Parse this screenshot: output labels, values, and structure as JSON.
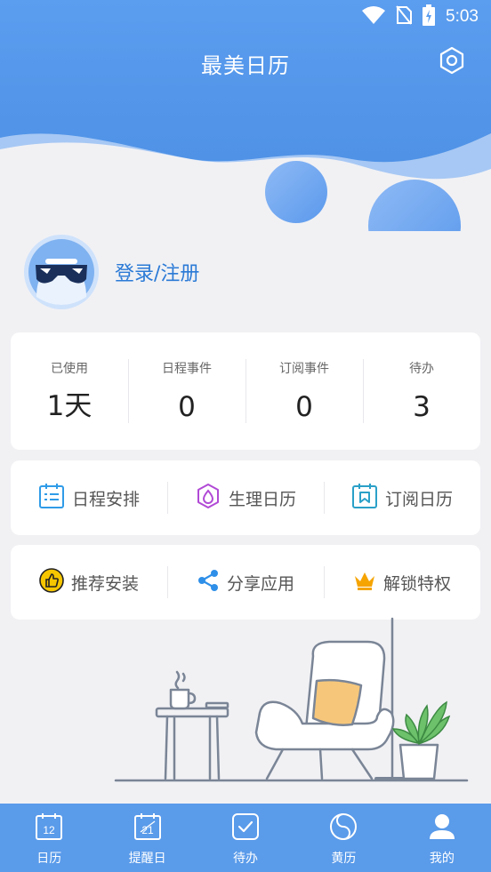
{
  "status_bar": {
    "time": "5:03",
    "icons": [
      "wifi-icon",
      "no-sim-icon",
      "battery-charging-icon"
    ]
  },
  "header": {
    "title": "最美日历",
    "settings_icon": "gear-icon"
  },
  "profile": {
    "login_label": "登录/注册",
    "avatar_icon": "avatar-sunglasses-icon"
  },
  "stats": [
    {
      "label": "已使用",
      "value": "1天"
    },
    {
      "label": "日程事件",
      "value": "0"
    },
    {
      "label": "订阅事件",
      "value": "0"
    },
    {
      "label": "待办",
      "value": "3"
    }
  ],
  "actions_row1": [
    {
      "label": "日程安排",
      "icon": "schedule-list-icon"
    },
    {
      "label": "生理日历",
      "icon": "droplet-icon"
    },
    {
      "label": "订阅日历",
      "icon": "bookmark-calendar-icon"
    }
  ],
  "actions_row2": [
    {
      "label": "推荐安装",
      "icon": "thumbs-up-icon"
    },
    {
      "label": "分享应用",
      "icon": "share-icon"
    },
    {
      "label": "解锁特权",
      "icon": "crown-icon"
    }
  ],
  "tabbar": [
    {
      "label": "日历",
      "icon": "calendar-icon",
      "icon_text": "12"
    },
    {
      "label": "提醒日",
      "icon": "reminder-icon",
      "icon_text": "21"
    },
    {
      "label": "待办",
      "icon": "checkbox-icon"
    },
    {
      "label": "黄历",
      "icon": "yin-yang-icon"
    },
    {
      "label": "我的",
      "icon": "person-icon"
    }
  ],
  "colors": {
    "primary": "#5a9bea",
    "link": "#2b7ad6",
    "background": "#f1f1f4"
  }
}
